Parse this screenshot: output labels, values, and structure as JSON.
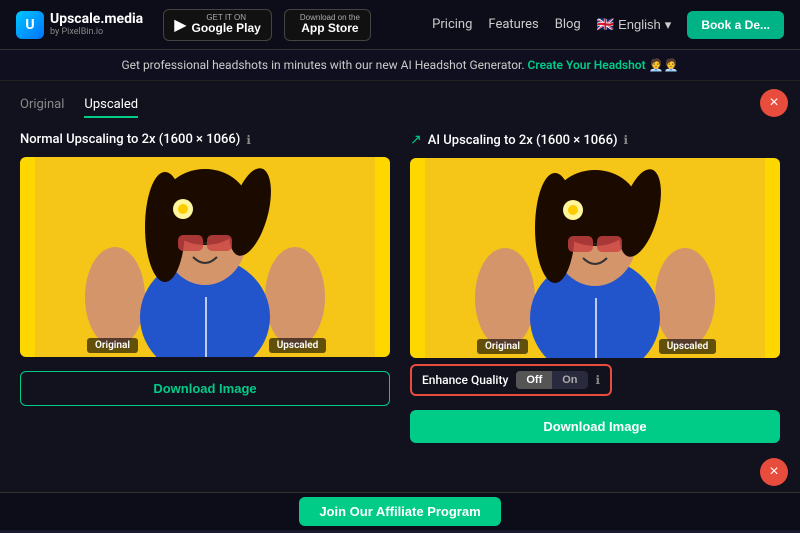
{
  "navbar": {
    "logo": "Upscale.media",
    "logo_sub": "by PixelBin.io",
    "google_play_label": "GET IT ON",
    "google_play_title": "Google Play",
    "app_store_label": "Download on the",
    "app_store_title": "App Store",
    "links": [
      "Pricing",
      "Features",
      "Blog"
    ],
    "lang": "English",
    "book_demo": "Book a De..."
  },
  "promo": {
    "text": "Get professional headshots in minutes with our new AI Headshot Generator.",
    "cta": "Create Your Headshot",
    "emoji": "🧑‍💼🧑‍💼"
  },
  "tabs": [
    {
      "label": "Original",
      "active": false
    },
    {
      "label": "Upscaled",
      "active": true
    }
  ],
  "columns": [
    {
      "id": "normal",
      "title": "Normal Upscaling to 2x (1600 × 1066)",
      "has_ai_icon": false,
      "download_label": "Download Image",
      "download_style": "outline"
    },
    {
      "id": "ai",
      "title": "AI Upscaling to 2x (1600 × 1066)",
      "has_ai_icon": true,
      "download_label": "Download Image",
      "download_style": "filled",
      "enhance_quality": {
        "label": "Enhance Quality",
        "off_label": "Off",
        "on_label": "On"
      }
    }
  ],
  "slider_labels": {
    "original": "Original",
    "upscaled": "Upscaled"
  },
  "affiliate": {
    "cta": "Join Our Affiliate Program"
  },
  "icons": {
    "close": "×",
    "info": "ℹ",
    "ai_sparkle": "↗",
    "chevron_down": "▾",
    "flag": "🇬🇧"
  }
}
